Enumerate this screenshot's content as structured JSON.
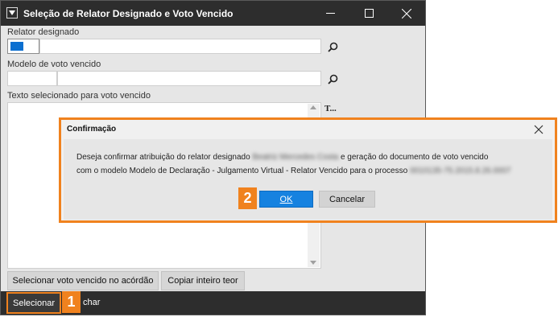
{
  "window": {
    "title": "Seleção de Relator Designado e Voto Vencido"
  },
  "form": {
    "relator_label": "Relator designado",
    "relator_value": "",
    "modelo_label": "Modelo de voto vencido",
    "modelo_code_value": "",
    "modelo_name_value": "",
    "texto_label": "Texto selecionado para voto vencido",
    "texto_value": "",
    "text_format_button": "T..."
  },
  "buttons": {
    "selecionar_voto": "Selecionar voto vencido no acórdão",
    "copiar_teor": "Copiar inteiro teor",
    "selecionar": "Selecionar",
    "cancelar_partial": "char"
  },
  "badges": {
    "step1": "1",
    "step2": "2"
  },
  "dialog": {
    "title": "Confirmação",
    "message_part1": "Deseja confirmar atribuição do relator designado",
    "relator_name_blurred": "Beatriz Mercedes Costa",
    "message_part2": "e geração do documento de voto vencido",
    "message_part3": "com o modelo Modelo de Declaração - Julgamento Virtual - Relator Vencido para o processo",
    "process_number_blurred": "0010135-75.2015.8.26.0007",
    "ok_label": "OK",
    "cancel_label": "Cancelar"
  },
  "colors": {
    "titlebar": "#2d2d2d",
    "accent_orange": "#f0821e",
    "ok_blue": "#1682e0",
    "selection_blue": "#0b6fd0"
  },
  "icons": [
    "app-icon",
    "minimize-icon",
    "maximize-icon",
    "close-icon",
    "search-icon"
  ]
}
